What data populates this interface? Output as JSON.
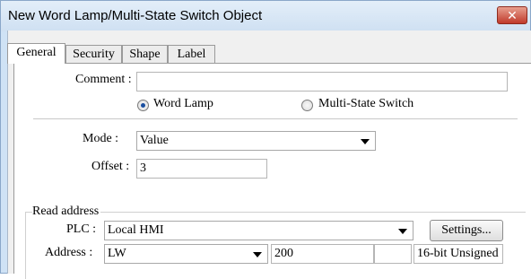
{
  "window": {
    "title": "New Word Lamp/Multi-State Switch Object",
    "close_glyph": "✕"
  },
  "tabs": [
    {
      "label": "General",
      "active": true
    },
    {
      "label": "Security",
      "active": false
    },
    {
      "label": "Shape",
      "active": false
    },
    {
      "label": "Label",
      "active": false
    }
  ],
  "general": {
    "comment_label": "Comment :",
    "comment_value": "",
    "object_type": {
      "options": [
        "Word Lamp",
        "Multi-State Switch"
      ],
      "selected": "Word Lamp"
    },
    "mode_label": "Mode :",
    "mode_value": "Value",
    "offset_label": "Offset :",
    "offset_value": "3"
  },
  "read_address": {
    "group_label": "Read address",
    "plc_label": "PLC :",
    "plc_value": "Local HMI",
    "settings_button": "Settings...",
    "address_label": "Address :",
    "device_type": "LW",
    "address_value": "200",
    "extra_value": "",
    "data_format": "16-bit Unsigned"
  }
}
